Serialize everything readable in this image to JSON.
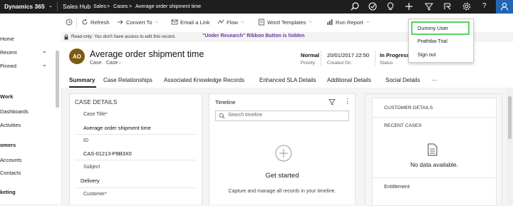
{
  "topbar": {
    "app_title": "Dynamics 365",
    "app_name": "Sales Hub",
    "breadcrumb": [
      "Sales",
      "Cases",
      "Average order shipment time"
    ]
  },
  "leftnav": {
    "items": [
      {
        "label": "Home"
      },
      {
        "label": "Recent"
      },
      {
        "label": "Pinned"
      }
    ],
    "groups": [
      {
        "title": "Work",
        "items": [
          "Dashboards",
          "Activities"
        ]
      },
      {
        "title": "omers",
        "items": [
          "Accounts",
          "Contacts"
        ]
      },
      {
        "title": "keting",
        "items": []
      }
    ]
  },
  "commands": {
    "refresh": "Refresh",
    "convert": "Convert To",
    "email": "Email a Link",
    "flow": "Flow",
    "word": "Word Templates",
    "report": "Run Report"
  },
  "notification": {
    "readonly": "Read-only: You don't have access to edit this record.",
    "ribbon": "\"Under Research\" Ribbon Button is hidden"
  },
  "record": {
    "initials": "AO",
    "title": "Average order shipment time",
    "entity": "Case",
    "form": "Case",
    "priority_value": "Normal",
    "priority_label": "Priority",
    "created_value": "20/01/2017 22:50",
    "created_label": "Created On",
    "status_value": "In Progress",
    "status_label": "Status"
  },
  "tabs": [
    "Summary",
    "Case Relationships",
    "Associated Knowledge Records",
    "Enhanced SLA Details",
    "Additional Details",
    "Social Details",
    "···"
  ],
  "case_details": {
    "heading": "CASE DETAILS",
    "title_label": "Case Title",
    "title_value": "Average order shipment time",
    "id_label": "ID",
    "id_value": "CAS-01213-P8B3X0",
    "subject_label": "Subject",
    "subject_value": "Delivery",
    "customer_label": "Customer",
    "required_mark": "*"
  },
  "timeline": {
    "heading": "Timeline",
    "search_placeholder": "Search timeline",
    "get_started": "Get started",
    "description": "Capture and manage all records in your timeline."
  },
  "customer_panel": {
    "heading": "CUSTOMER DETAILS",
    "recent_cases": "RECENT CASES",
    "no_data": "No data available.",
    "entitlement": "Entitlement"
  },
  "user_menu": {
    "items": [
      "Dummy User",
      "Prathiba-Trial",
      "Sign out"
    ]
  },
  "colors": {
    "topbar": "#1e1e1e",
    "user_button": "#2266b1",
    "avatar": "#7c5a12",
    "highlight_border": "#5ed15e",
    "ribbon_text": "#6a3aa0"
  }
}
